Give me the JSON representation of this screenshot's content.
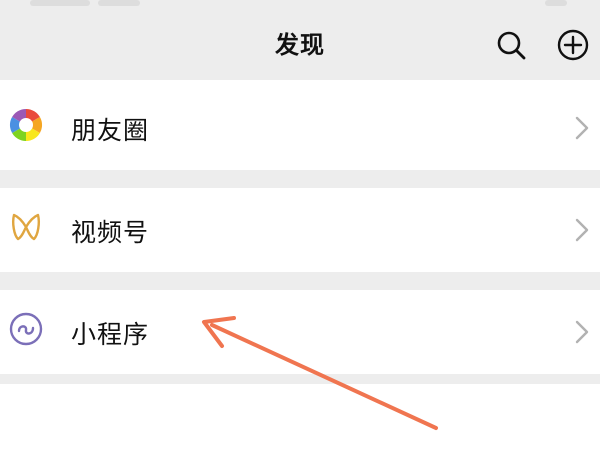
{
  "header": {
    "title": "发现",
    "search_icon": "search-icon",
    "add_icon": "plus-circle-icon"
  },
  "list": {
    "items": [
      {
        "label": "朋友圈",
        "icon": "moments-aperture-icon"
      },
      {
        "label": "视频号",
        "icon": "channels-butterfly-icon"
      },
      {
        "label": "小程序",
        "icon": "mini-program-icon"
      }
    ]
  },
  "colors": {
    "background": "#ededed",
    "row": "#ffffff",
    "text": "#111111",
    "chevron": "#b2b2b2",
    "annotation_arrow": "#f07550"
  }
}
